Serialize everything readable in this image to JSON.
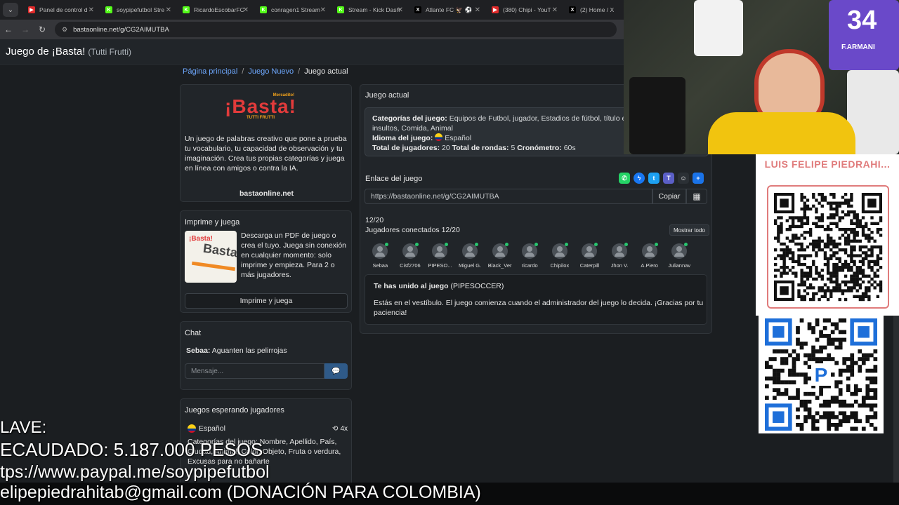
{
  "browser": {
    "tabs": [
      {
        "title": "Panel de control d",
        "color": "#e02b2b",
        "glyph": "▶"
      },
      {
        "title": "soypipefutbol Stre",
        "color": "#53fc18",
        "glyph": "K"
      },
      {
        "title": "RicardoEscobarFC",
        "color": "#53fc18",
        "glyph": "K"
      },
      {
        "title": "conragen1 Stream",
        "color": "#53fc18",
        "glyph": "K"
      },
      {
        "title": "Stream - Kick Dash",
        "color": "#53fc18",
        "glyph": "K"
      },
      {
        "title": "Atlante FC 🦅 ⚽",
        "color": "#000000",
        "glyph": "X"
      },
      {
        "title": "(380) Chipi - YouT",
        "color": "#e02b2b",
        "glyph": "▶"
      },
      {
        "title": "(2) Home / X",
        "color": "#000000",
        "glyph": "X"
      }
    ],
    "url": "bastaonline.net/g/CG2AIMUTBA"
  },
  "site": {
    "title": "Juego de ¡Basta!",
    "subtitle": "(Tutti Frutti)"
  },
  "breadcrumb": {
    "home": "Página principal",
    "new_game": "Juego Nuevo",
    "current": "Juego actual"
  },
  "intro": {
    "logo_top": "Mercadito!",
    "logo_main": "¡Basta!",
    "logo_sub": "TUTTI FRUTTI",
    "description": "Un juego de palabras creativo que pone a prueba tu vocabulario, tu capacidad de observación y tu imaginación. Crea tus propias categorías y juega en línea con amigos o contra la IA.",
    "domain": "bastaonline.net"
  },
  "print": {
    "title": "Imprime y juega",
    "thumb_brand": "¡Basta!",
    "thumb_text": "Basta",
    "description": "Descarga un PDF de juego o crea el tuyo. Juega sin conexión en cualquier momento: solo imprime y empieza. Para 2 o más jugadores.",
    "button": "Imprime y juega"
  },
  "chat": {
    "title": "Chat",
    "messages": [
      {
        "user": "Sebaa:",
        "text": "Aguanten las pelirrojas"
      }
    ],
    "placeholder": "Mensaje..."
  },
  "waiting": {
    "title": "Juegos esperando jugadores",
    "language": "Español",
    "count": "4x",
    "categories": "Categorías del juego: Nombre, Apellido, País, Ciudad, Animal, Color, Objeto, Fruta o verdura, Excusas para no bañarte"
  },
  "game": {
    "header": "Juego actual",
    "categories_label": "Categorías del juego:",
    "categories_value": "Equipos de Futbol, jugador, Estadios de fútbol, título excusas para ser infiel, insultos, Comida, Animal",
    "language_label": "Idioma del juego:",
    "language_value": "Español",
    "players_label": "Total de jugadores:",
    "players_value": "20",
    "rounds_label": "Total de rondas:",
    "rounds_value": "5",
    "timer_label": "Cronómetro:",
    "timer_value": "60s",
    "link_label": "Enlace del juego",
    "link_value": "https://bastaonline.net/g/CG2AIMUTBA",
    "copy_button": "Copiar",
    "ratio": "12/20",
    "connected_label": "Jugadores conectados 12/20",
    "show_all": "Mostrar todo",
    "players": [
      "Sebaa",
      "Cisf2706",
      "PIPESO...",
      "Miguel G.",
      "Black_Ver",
      "ricardo",
      "Chipilox",
      "Caterpill",
      "Jhon V.",
      "A.Piero",
      "Juliannav"
    ],
    "joined_title": "Te has unido al juego",
    "joined_name": "(PIPESOCCER)",
    "lobby_message": "Estás en el vestíbulo. El juego comienza cuando el administrador del juego lo decida. ¡Gracias por tu paciencia!"
  },
  "stream_overlay": {
    "qr_title": "LUIS FELIPE PIEDRAHI...",
    "line1": "LAVE:",
    "line2": "ECAUDADO: 5.187.000 PESOS",
    "line3": "tps://www.paypal.me/soypipefutbol",
    "line4": "elipepiedrahitab@gmail.com (DONACIÓN PARA COLOMBIA)",
    "jersey_number": "34",
    "jersey_name": "F.ARMANI"
  },
  "colors": {
    "accent_link": "#6ea8fe",
    "logo_red": "#e23b3b",
    "logo_orange": "#f3a31b",
    "online_green": "#28c76f",
    "whatsapp": "#25d366",
    "messenger": "#1877f2",
    "twitter": "#1da1f2",
    "teams": "#5b5fc7",
    "snapchat": "#2b3035",
    "plus": "#1a73e8"
  }
}
